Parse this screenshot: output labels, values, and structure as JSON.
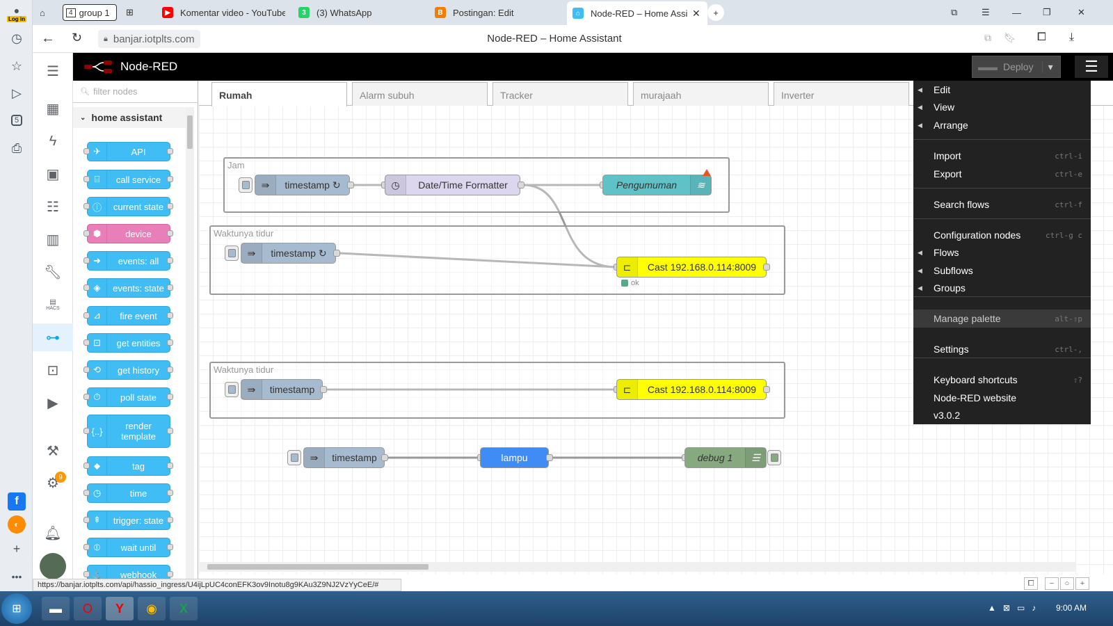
{
  "browser": {
    "login_label": "Log in",
    "tabs": [
      {
        "label": "group 1",
        "icon": "tab-group-icon",
        "count": "4"
      },
      {
        "label": "Komentar video - YouTube",
        "icon": "youtube-icon",
        "color": "#ff0000"
      },
      {
        "label": "(3) WhatsApp",
        "icon": "whatsapp-icon",
        "color": "#25d366",
        "badge": "3"
      },
      {
        "label": "Postingan: Edit",
        "icon": "blogger-icon",
        "color": "#f57d00"
      },
      {
        "label": "Node-RED – Home Assis",
        "icon": "home-assistant-icon",
        "color": "#41bdf5",
        "active": true
      }
    ],
    "url": "banjar.iotplts.com",
    "page_title": "Node-RED – Home Assistant",
    "status_url": "https://banjar.iotplts.com/api/hassio_ingress/U4ijLpUC4conEFK3ov9Inotu8g9KAu3Z9NJ2VzYyCeE/#",
    "side_badge": "5"
  },
  "ha": {
    "settings_badge": "9"
  },
  "nodered": {
    "logo_text": "Node-RED",
    "deploy_label": "Deploy",
    "filter_placeholder": "filter nodes",
    "palette_category": "home assistant",
    "palette_nodes": [
      "API",
      "call service",
      "current state",
      "device",
      "events: all",
      "events: state",
      "fire event",
      "get entities",
      "get history",
      "poll state",
      "render\ntemplate",
      "tag",
      "time",
      "trigger: state",
      "wait until",
      "webhook"
    ],
    "workspace_tabs": [
      "Rumah",
      "Alarm subuh",
      "Tracker",
      "murajaah",
      "Inverter"
    ],
    "groups": [
      "Jam",
      "Waktunya tidur",
      "Waktunya tidur"
    ],
    "nodes": {
      "ts1": "timestamp ↻",
      "formatter": "Date/Time Formatter",
      "pengumuman": "Pengumuman",
      "ts2": "timestamp ↻",
      "cast1": "Cast 192.168.0.114:8009",
      "cast1_status": "ok",
      "ts3": "timestamp",
      "cast2": "Cast 192.168.0.114:8009",
      "ts4": "timestamp",
      "lampu": "lampu",
      "debug": "debug 1"
    },
    "menu": [
      {
        "label": "Edit",
        "sub": true,
        "kb": ""
      },
      {
        "label": "View",
        "sub": true,
        "kb": ""
      },
      {
        "label": "Arrange",
        "sub": true,
        "kb": ""
      },
      {
        "label": "Import",
        "sub": false,
        "kb": "ctrl-i"
      },
      {
        "label": "Export",
        "sub": false,
        "kb": "ctrl-e"
      },
      {
        "label": "Search flows",
        "sub": false,
        "kb": "ctrl-f"
      },
      {
        "label": "Configuration nodes",
        "sub": false,
        "kb": "ctrl-g c"
      },
      {
        "label": "Flows",
        "sub": true,
        "kb": ""
      },
      {
        "label": "Subflows",
        "sub": true,
        "kb": ""
      },
      {
        "label": "Groups",
        "sub": true,
        "kb": ""
      },
      {
        "label": "Manage palette",
        "sub": false,
        "kb": "alt-⇧p"
      },
      {
        "label": "Settings",
        "sub": false,
        "kb": "ctrl-,"
      },
      {
        "label": "Keyboard shortcuts",
        "sub": false,
        "kb": "⇧?"
      },
      {
        "label": "Node-RED website",
        "sub": false,
        "kb": ""
      },
      {
        "label": "v3.0.2",
        "sub": false,
        "kb": ""
      }
    ]
  },
  "taskbar": {
    "clock": "9:00 AM"
  },
  "colors": {
    "ha_blue": "#41bdf5",
    "menu_bg": "#222222",
    "cast_yellow": "#ffff00",
    "inject_blue": "#a6bbcf"
  }
}
